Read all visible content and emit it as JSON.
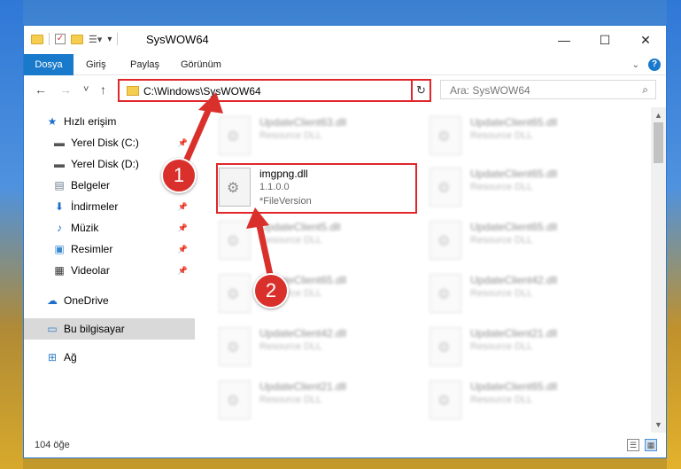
{
  "window": {
    "title": "SysWOW64",
    "controls": {
      "minimize": "—",
      "maximize": "☐",
      "close": "✕"
    }
  },
  "ribbon": {
    "tabs": [
      "Dosya",
      "Giriş",
      "Paylaş",
      "Görünüm"
    ],
    "help_label": "?",
    "expand_label": "⌄"
  },
  "nav": {
    "back": "←",
    "forward": "→",
    "recent": "˅",
    "up": "↑",
    "address": "C:\\Windows\\SysWOW64",
    "address_dropdown": "⌄",
    "refresh": "↻",
    "search_placeholder": "Ara: SysWOW64",
    "search_icon": "⌕"
  },
  "sidebar": {
    "items": [
      {
        "label": "Hızlı erişim",
        "icon": "star-icon",
        "pinned": false
      },
      {
        "label": "Yerel Disk (C:)",
        "icon": "drive-icon",
        "pinned": true
      },
      {
        "label": "Yerel Disk (D:)",
        "icon": "drive-icon",
        "pinned": true
      },
      {
        "label": "Belgeler",
        "icon": "documents-icon",
        "pinned": true
      },
      {
        "label": "İndirmeler",
        "icon": "download-icon",
        "pinned": true
      },
      {
        "label": "Müzik",
        "icon": "music-icon",
        "pinned": true
      },
      {
        "label": "Resimler",
        "icon": "pictures-icon",
        "pinned": true
      },
      {
        "label": "Videolar",
        "icon": "videos-icon",
        "pinned": true
      },
      {
        "label": "OneDrive",
        "icon": "cloud-icon",
        "pinned": false
      },
      {
        "label": "Bu bilgisayar",
        "icon": "computer-icon",
        "pinned": false
      },
      {
        "label": "Ağ",
        "icon": "network-icon",
        "pinned": false
      }
    ]
  },
  "files": [
    {
      "name": "UpdateClient63.dll",
      "type": "Resource DLL"
    },
    {
      "name": "UpdateClient65.dll",
      "type": "Resource DLL"
    },
    {
      "name": "imgpng.dll",
      "version": "1.1.0.0",
      "type": "*FileVersion"
    },
    {
      "name": "UpdateClient65.dll",
      "type": "Resource DLL"
    },
    {
      "name": "UpdateClient5.dll",
      "type": "Resource DLL"
    },
    {
      "name": "UpdateClient65.dll",
      "type": "Resource DLL"
    },
    {
      "name": "UpdateClient65.dll",
      "type": "Resource DLL"
    },
    {
      "name": "UpdateClient42.dll",
      "type": "Resource DLL"
    },
    {
      "name": "UpdateClient42.dll",
      "type": "Resource DLL"
    },
    {
      "name": "UpdateClient21.dll",
      "type": "Resource DLL"
    },
    {
      "name": "UpdateClient21.dll",
      "type": "Resource DLL"
    },
    {
      "name": "UpdateClient65.dll",
      "type": "Resource DLL"
    }
  ],
  "status": {
    "count": "104 öğe"
  },
  "annotations": {
    "step1": "1",
    "step2": "2",
    "color": "#d9302c"
  }
}
